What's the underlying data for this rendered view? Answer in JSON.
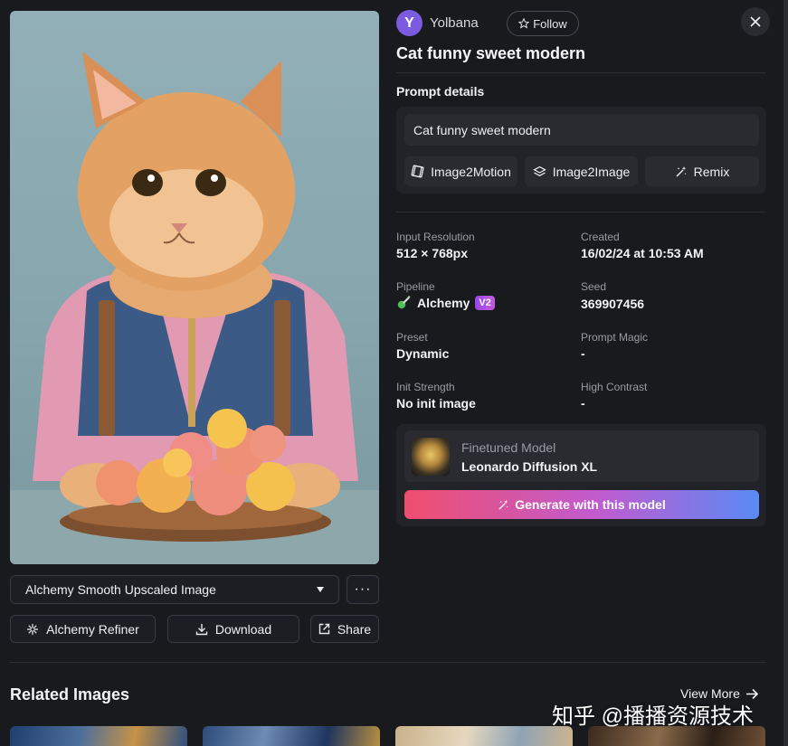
{
  "header": {
    "avatar_letter": "Y",
    "username": "Yolbana",
    "follow_label": "Follow",
    "title": "Cat funny sweet modern"
  },
  "prompt": {
    "section_title": "Prompt details",
    "text": "Cat funny sweet modern",
    "actions": [
      "Image2Motion",
      "Image2Image",
      "Remix"
    ]
  },
  "meta": {
    "input_resolution": {
      "label": "Input Resolution",
      "value": "512 × 768px"
    },
    "created": {
      "label": "Created",
      "value": "16/02/24 at 10:53 AM"
    },
    "pipeline": {
      "label": "Pipeline",
      "value": "Alchemy",
      "badge": "V2"
    },
    "seed": {
      "label": "Seed",
      "value": "369907456"
    },
    "preset": {
      "label": "Preset",
      "value": "Dynamic"
    },
    "prompt_magic": {
      "label": "Prompt Magic",
      "value": "-"
    },
    "init_strength": {
      "label": "Init Strength",
      "value": "No init image"
    },
    "high_contrast": {
      "label": "High Contrast",
      "value": "-"
    }
  },
  "model": {
    "label": "Finetuned Model",
    "name": "Leonardo Diffusion XL",
    "generate_label": "Generate with this model"
  },
  "image_controls": {
    "upscale_selected": "Alchemy Smooth Upscaled Image",
    "more_label": "···",
    "refiner_label": "Alchemy Refiner",
    "download_label": "Download",
    "share_label": "Share"
  },
  "related": {
    "title": "Related Images",
    "view_more": "View More"
  },
  "watermark": "知乎 @播播资源技术",
  "colors": {
    "background": "#191a1e",
    "panel": "#222328",
    "accent_gradient": [
      "#f04e6e",
      "#c05bd0",
      "#5a8af5"
    ],
    "avatar": "#7b5ce0"
  }
}
